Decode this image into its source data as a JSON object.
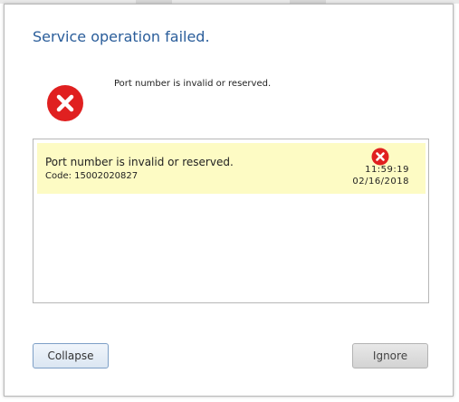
{
  "dialog": {
    "title": "Service operation failed.",
    "summary": "Port number is invalid or reserved.",
    "icon": "error-icon"
  },
  "detail": {
    "message": "Port number is invalid or reserved.",
    "code": "Code: 15002020827",
    "time": "11:59:19",
    "date": "02/16/2018",
    "icon": "error-icon"
  },
  "buttons": {
    "collapse": "Collapse",
    "ignore": "Ignore"
  },
  "colors": {
    "title": "#2a5d9a",
    "error_red": "#e02020",
    "highlight_row": "#fdfbc4"
  }
}
